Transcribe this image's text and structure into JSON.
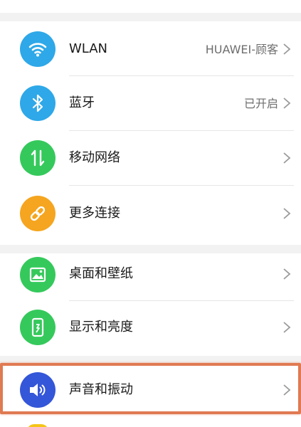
{
  "settings": {
    "items": [
      {
        "label": "WLAN",
        "value": "HUAWEI-顾客",
        "icon": "wifi-icon",
        "color": "#2ea8e8"
      },
      {
        "label": "蓝牙",
        "value": "已开启",
        "icon": "bluetooth-icon",
        "color": "#2ea8e8"
      },
      {
        "label": "移动网络",
        "value": "",
        "icon": "mobile-network-icon",
        "color": "#35c95c"
      },
      {
        "label": "更多连接",
        "value": "",
        "icon": "link-icon",
        "color": "#f5a51f"
      },
      {
        "label": "桌面和壁纸",
        "value": "",
        "icon": "image-icon",
        "color": "#35c95c"
      },
      {
        "label": "显示和亮度",
        "value": "",
        "icon": "phone-display-icon",
        "color": "#35c95c"
      },
      {
        "label": "声音和振动",
        "value": "",
        "icon": "speaker-icon",
        "color": "#3456d8"
      }
    ],
    "highlight_color": "#e07a52"
  }
}
